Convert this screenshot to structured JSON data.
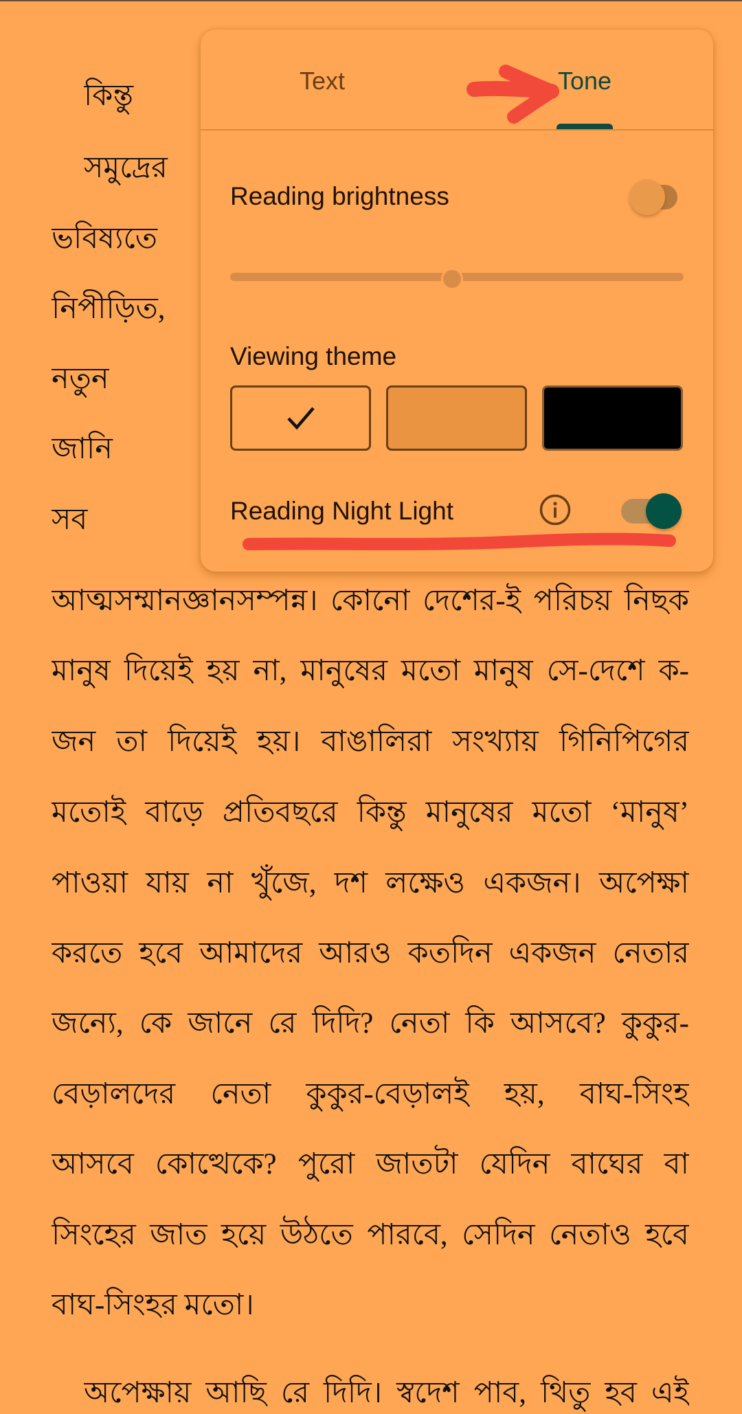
{
  "reader": {
    "lines": [
      "কিন্তু যাব",
      "সমুদ্রের জ",
      "ভবিষ্যতে এ",
      "নিপীড়িত, নি",
      "নতুন ইজরা",
      "জানি যে, এ",
      "সব মানুষ দি",
      "আত্মসম্মানজ্ঞানসম্পন্ন। কোনো দেশের-ই পরিচয় নিছক",
      "মানুষ দিয়েই হয় না, মানুষের মতো মানুষ সে-দেশে ক-",
      "জন তা দিয়েই হয়। বাঙালিরা সংখ্যায় গিনিপিগের",
      "মতোই বাড়ে প্রতিবছরে কিন্তু মানুষের মতো ‘মানুষ’",
      "পাওয়া যায় না খুঁজে, দশ লক্ষেও একজন। অপেক্ষা",
      "করতে হবে আমাদের আরও কতদিন একজন নেতার",
      "জন্যে, কে জানে রে দিদি? নেতা কি আসবে? কুকুর-",
      "বেড়ালদের নেতা কুকুর-বেড়ালই হয়, বাঘ-সিংহ",
      "আসবে কোত্থেকে? পুরো জাতটা যেদিন বাঘের বা",
      "সিংহের জাত হয়ে উঠতে পারবে, সেদিন নেতাও হবে",
      "বাঘ-সিংহর মতো।",
      "অপেক্ষায় আছি রে দিদি। স্বদেশ পাব, থিতু হব এই"
    ]
  },
  "panel": {
    "tabs": [
      {
        "label": "Text",
        "selected": false
      },
      {
        "label": "Tone",
        "selected": true
      }
    ],
    "reading_brightness": {
      "label": "Reading brightness",
      "enabled": false,
      "slider_value_percent": 49
    },
    "viewing_theme": {
      "label": "Viewing theme",
      "options": [
        {
          "name": "light-orange",
          "color": "#FFA654",
          "selected": true,
          "icon": "check-icon"
        },
        {
          "name": "sepia",
          "color": "#EA9442",
          "selected": false
        },
        {
          "name": "dark",
          "color": "#000000",
          "selected": false
        }
      ]
    },
    "reading_night_light": {
      "label": "Reading Night Light",
      "info_icon": "info-icon",
      "enabled": true
    }
  },
  "colors": {
    "background": "#FFA654",
    "accent": "#045244",
    "annotation": "#F2483A"
  }
}
